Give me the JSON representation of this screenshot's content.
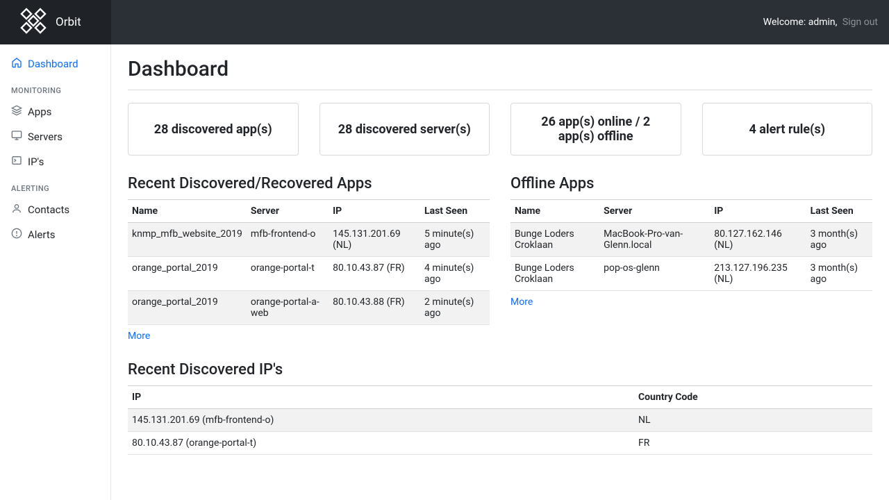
{
  "header": {
    "brand": "Orbit",
    "welcome_prefix": "Welcome:",
    "username": "admin",
    "separator": ",",
    "signout": "Sign out"
  },
  "sidebar": {
    "items": [
      {
        "label": "Dashboard",
        "icon": "home-icon",
        "active": true
      }
    ],
    "groups": [
      {
        "heading": "MONITORING",
        "items": [
          {
            "label": "Apps",
            "icon": "layers-icon"
          },
          {
            "label": "Servers",
            "icon": "monitor-icon"
          },
          {
            "label": "IP's",
            "icon": "terminal-icon"
          }
        ]
      },
      {
        "heading": "ALERTING",
        "items": [
          {
            "label": "Contacts",
            "icon": "user-icon"
          },
          {
            "label": "Alerts",
            "icon": "alert-icon"
          }
        ]
      }
    ]
  },
  "page": {
    "title": "Dashboard"
  },
  "cards": [
    "28 discovered app(s)",
    "28 discovered server(s)",
    "26 app(s) online / 2 app(s) offline",
    "4 alert rule(s)"
  ],
  "recent_apps": {
    "title": "Recent Discovered/Recovered Apps",
    "columns": [
      "Name",
      "Server",
      "IP",
      "Last Seen"
    ],
    "rows": [
      {
        "name": "knmp_mfb_website_2019",
        "server": "mfb-frontend-o",
        "ip": "145.131.201.69 (NL)",
        "last_seen": "5 minute(s) ago"
      },
      {
        "name": "orange_portal_2019",
        "server": "orange-portal-t",
        "ip": "80.10.43.87 (FR)",
        "last_seen": "4 minute(s) ago"
      },
      {
        "name": "orange_portal_2019",
        "server": "orange-portal-a-web",
        "ip": "80.10.43.88 (FR)",
        "last_seen": "2 minute(s) ago"
      }
    ],
    "more": "More"
  },
  "offline_apps": {
    "title": "Offline Apps",
    "columns": [
      "Name",
      "Server",
      "IP",
      "Last Seen"
    ],
    "rows": [
      {
        "name": "Bunge Loders Croklaan",
        "server": "MacBook-Pro-van-Glenn.local",
        "ip": "80.127.162.146 (NL)",
        "last_seen": "3 month(s) ago"
      },
      {
        "name": "Bunge Loders Croklaan",
        "server": "pop-os-glenn",
        "ip": "213.127.196.235 (NL)",
        "last_seen": "3 month(s) ago"
      }
    ],
    "more": "More"
  },
  "recent_ips": {
    "title": "Recent Discovered IP's",
    "columns": [
      "IP",
      "Country Code"
    ],
    "rows": [
      {
        "ip": "145.131.201.69 (mfb-frontend-o)",
        "cc": "NL"
      },
      {
        "ip": "80.10.43.87 (orange-portal-t)",
        "cc": "FR"
      }
    ]
  }
}
